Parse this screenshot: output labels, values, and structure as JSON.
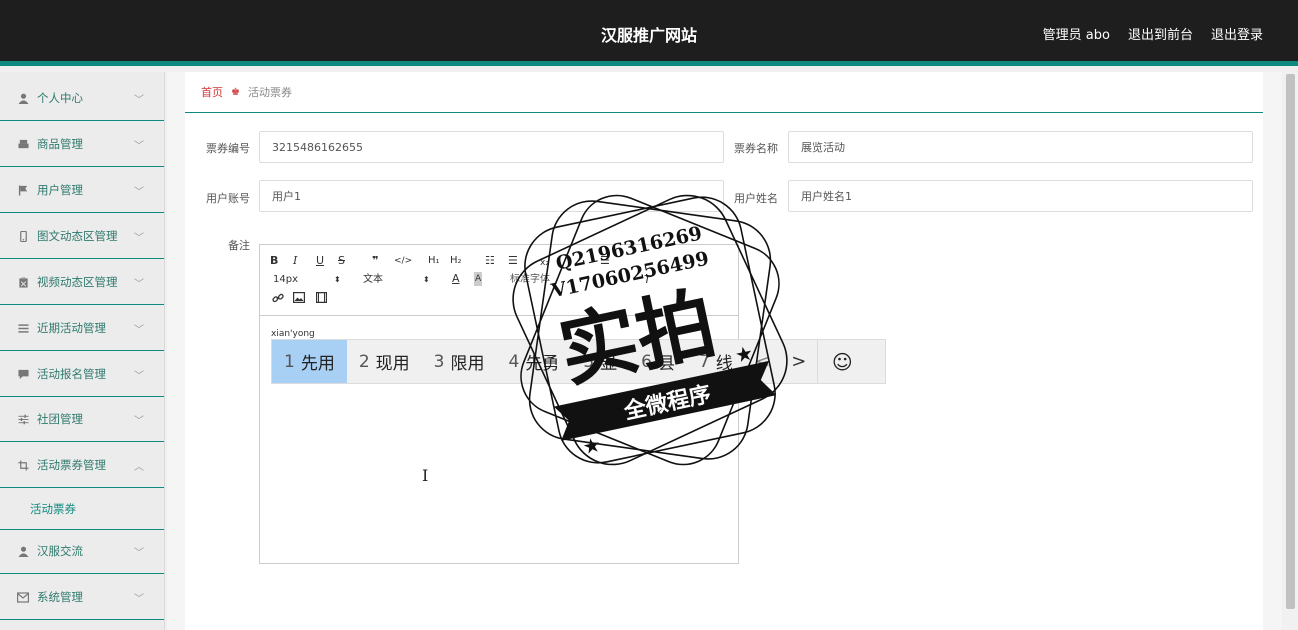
{
  "header": {
    "title": "汉服推广网站",
    "admin": "管理员 abo",
    "to_front": "退出到前台",
    "logout": "退出登录"
  },
  "sidebar": {
    "items": [
      {
        "label": "个人中心",
        "icon": "user-icon"
      },
      {
        "label": "商品管理",
        "icon": "print-icon"
      },
      {
        "label": "用户管理",
        "icon": "flag-icon"
      },
      {
        "label": "图文动态区管理",
        "icon": "phone-icon"
      },
      {
        "label": "视频动态区管理",
        "icon": "clipboard-icon"
      },
      {
        "label": "近期活动管理",
        "icon": "list-icon"
      },
      {
        "label": "活动报名管理",
        "icon": "comment-icon"
      },
      {
        "label": "社团管理",
        "icon": "sliders-icon"
      },
      {
        "label": "活动票券管理",
        "icon": "crop-icon"
      },
      {
        "label": "汉服交流",
        "icon": "user-icon"
      },
      {
        "label": "系统管理",
        "icon": "mail-icon"
      }
    ],
    "sub_item": "活动票券"
  },
  "breadcrumb": {
    "home": "首页",
    "current": "活动票券"
  },
  "form": {
    "ticket_no_label": "票券编号",
    "ticket_no_value": "3215486162655",
    "ticket_name_label": "票券名称",
    "ticket_name_value": "展览活动",
    "account_label": "用户账号",
    "account_value": "用户1",
    "username_label": "用户姓名",
    "username_value": "用户姓名1",
    "remark_label": "备注"
  },
  "editor": {
    "font_size": "14px",
    "paragraph": "文本",
    "font_family": "标准字体",
    "typed_text": "xian'yong"
  },
  "ime": {
    "candidates": [
      {
        "n": "1",
        "text": "先用"
      },
      {
        "n": "2",
        "text": "现用"
      },
      {
        "n": "3",
        "text": "限用"
      },
      {
        "n": "4",
        "text": "先勇"
      },
      {
        "n": "5",
        "text": "显"
      },
      {
        "n": "6",
        "text": "县"
      },
      {
        "n": "7",
        "text": "线"
      }
    ],
    "prev": "<",
    "next": ">",
    "emoji": "☺"
  },
  "watermark": {
    "line1": "Q2196316269",
    "line2": "V17060256499",
    "main": "实拍",
    "banner": "全微程序"
  }
}
